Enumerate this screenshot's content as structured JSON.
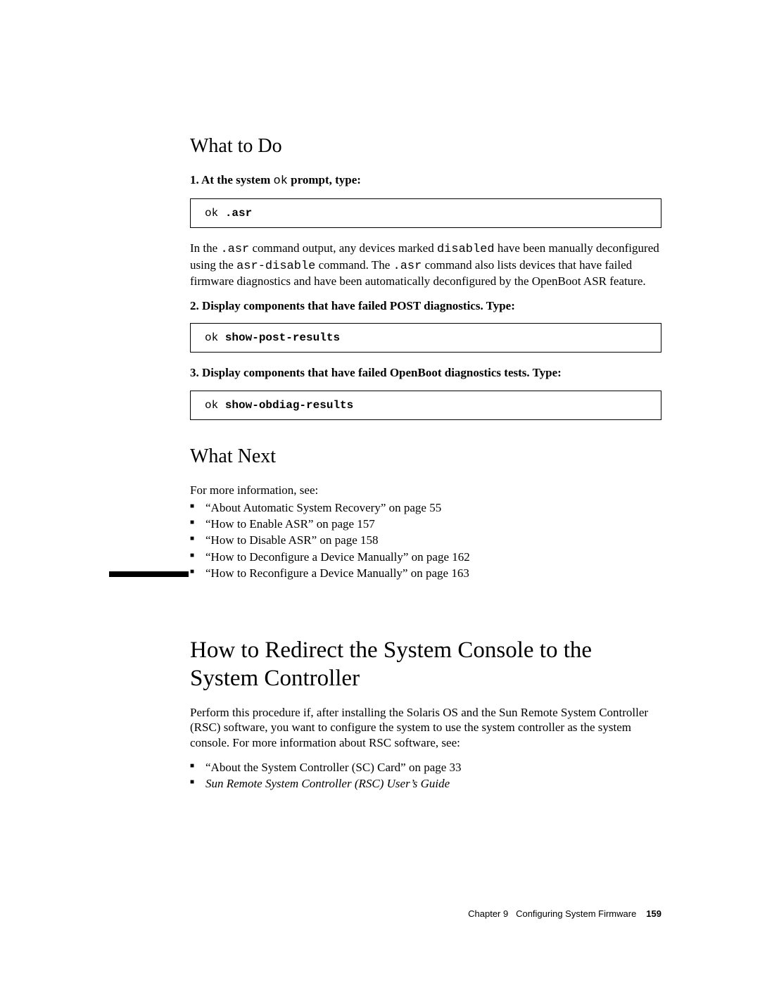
{
  "section1": {
    "heading": "What to Do",
    "step1_prefix": "1. At the system ",
    "step1_code": "ok",
    "step1_suffix": " prompt, type:",
    "code1_prompt": "ok ",
    "code1_cmd": ".asr",
    "para1_a": "In the ",
    "para1_code1": ".asr",
    "para1_b": " command output, any devices marked ",
    "para1_code2": "disabled",
    "para1_c": " have been manually deconfigured using the ",
    "para1_code3": "asr-disable",
    "para1_d": " command. The ",
    "para1_code4": ".asr",
    "para1_e": " command also lists devices that have failed firmware diagnostics and have been automatically deconfigured by the OpenBoot ASR feature.",
    "step2": "2. Display components that have failed POST diagnostics. Type:",
    "code2_prompt": "ok ",
    "code2_cmd": "show-post-results",
    "step3": "3. Display components that have failed OpenBoot diagnostics tests. Type:",
    "code3_prompt": "ok ",
    "code3_cmd": "show-obdiag-results"
  },
  "section2": {
    "heading": "What Next",
    "intro": "For more information, see:",
    "items": [
      "“About Automatic System Recovery” on page 55",
      "“How to Enable ASR” on page 157",
      "“How to Disable ASR” on page 158",
      "“How to Deconfigure a Device Manually” on page 162",
      "“How to Reconfigure a Device Manually” on page 163"
    ]
  },
  "section3": {
    "heading": "How to Redirect the System Console to the System Controller",
    "intro": "Perform this procedure if, after installing the Solaris OS and the Sun Remote System Controller (RSC) software, you want to configure the system to use the system controller as the system console. For more information about RSC software, see:",
    "items": [
      "“About the System Controller (SC) Card” on page 33"
    ],
    "italic_item": "Sun Remote System Controller (RSC) User’s Guide"
  },
  "footer": {
    "chapter": "Chapter 9",
    "title": "Configuring System Firmware",
    "page": "159"
  }
}
